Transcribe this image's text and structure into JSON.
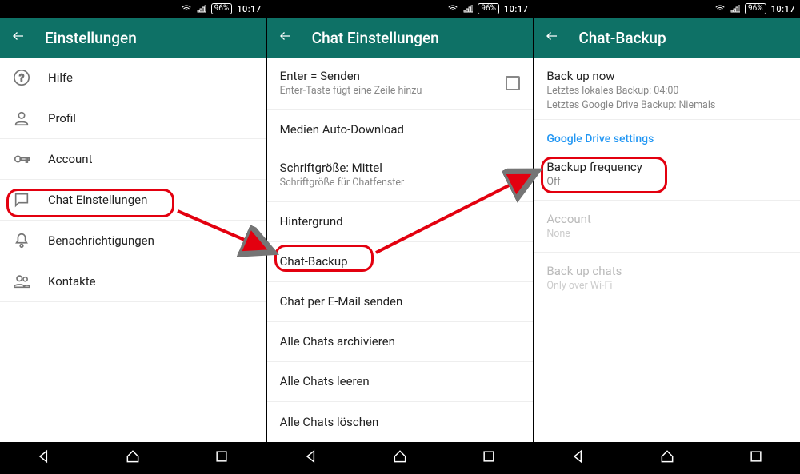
{
  "statusbar": {
    "battery": "96%",
    "time": "10:17"
  },
  "panel1": {
    "title": "Einstellungen",
    "items": [
      {
        "label": "Hilfe"
      },
      {
        "label": "Profil"
      },
      {
        "label": "Account"
      },
      {
        "label": "Chat Einstellungen"
      },
      {
        "label": "Benachrichtigungen"
      },
      {
        "label": "Kontakte"
      }
    ]
  },
  "panel2": {
    "title": "Chat Einstellungen",
    "items": [
      {
        "label": "Enter = Senden",
        "sub": "Enter-Taste fügt eine Zeile hinzu"
      },
      {
        "label": "Medien Auto-Download"
      },
      {
        "label": "Schriftgröße: Mittel",
        "sub": "Schriftgröße für Chatfenster"
      },
      {
        "label": "Hintergrund"
      },
      {
        "label": "Chat-Backup"
      },
      {
        "label": "Chat per E-Mail senden"
      },
      {
        "label": "Alle Chats archivieren"
      },
      {
        "label": "Alle Chats leeren"
      },
      {
        "label": "Alle Chats löschen"
      }
    ]
  },
  "panel3": {
    "title": "Chat-Backup",
    "backup_now": {
      "label": "Back up now",
      "line1": "Letztes lokales Backup: 04:00",
      "line2": "Letztes Google Drive Backup: Niemals"
    },
    "gd_header": "Google Drive settings",
    "freq": {
      "label": "Backup frequency",
      "value": "Off"
    },
    "account": {
      "label": "Account",
      "value": "None"
    },
    "chats": {
      "label": "Back up chats",
      "value": "Only over Wi-Fi"
    }
  }
}
